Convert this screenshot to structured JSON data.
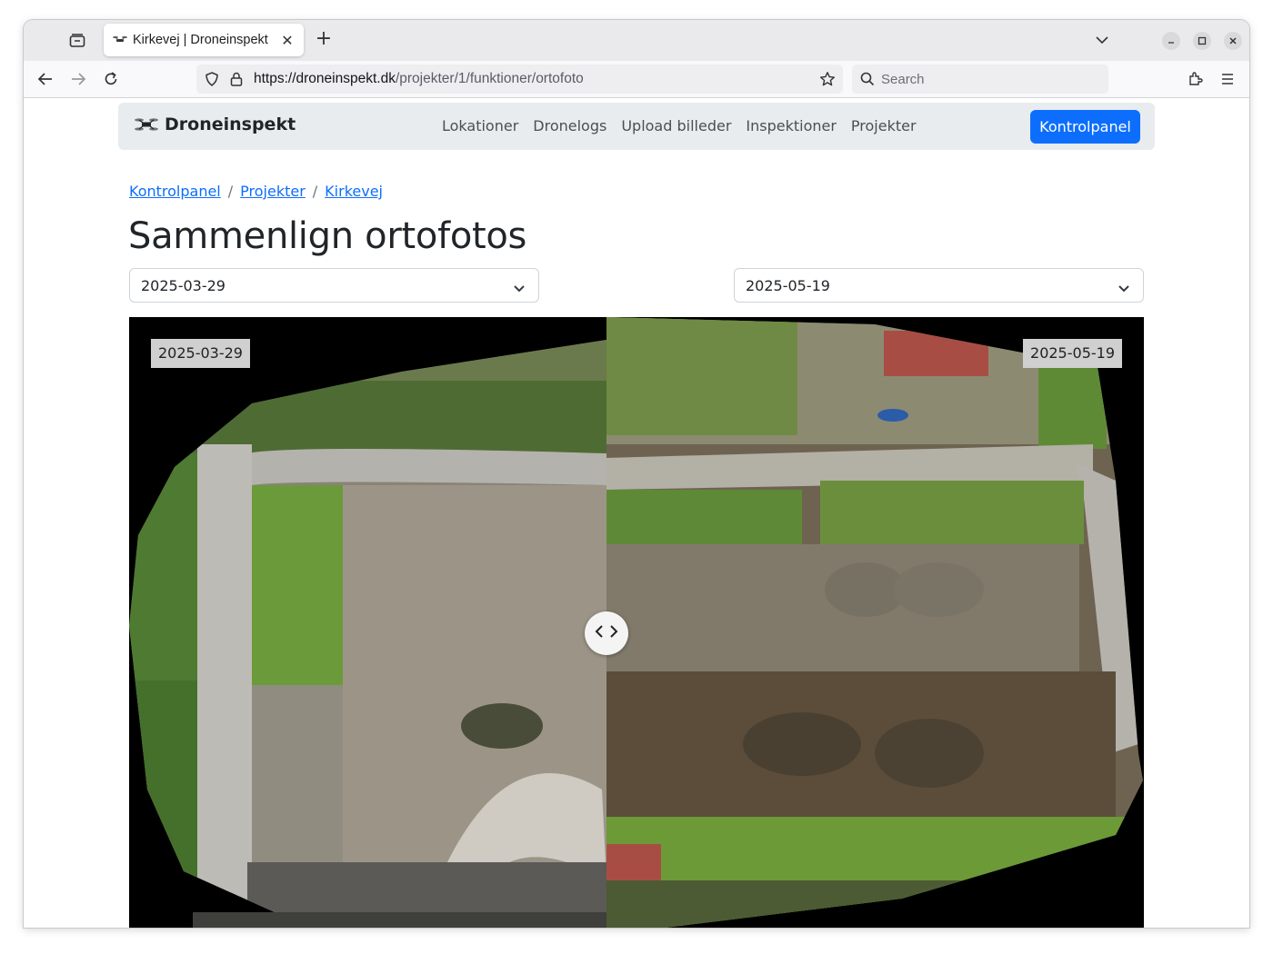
{
  "browser": {
    "tab_title": "Kirkevej | Droneinspekt",
    "url_host": "https://droneinspekt.dk",
    "url_path": "/projekter/1/funktioner/ortofoto",
    "search_placeholder": "Search"
  },
  "nav": {
    "brand": "Droneinspekt",
    "links": [
      "Lokationer",
      "Dronelogs",
      "Upload billeder",
      "Inspektioner",
      "Projekter"
    ],
    "cta": "Kontrolpanel"
  },
  "breadcrumb": {
    "items": [
      "Kontrolpanel",
      "Projekter",
      "Kirkevej"
    ],
    "separator": "/"
  },
  "page": {
    "title": "Sammenlign ortofotos"
  },
  "selects": {
    "left_value": "2025-03-29",
    "right_value": "2025-05-19"
  },
  "compare": {
    "left_label": "2025-03-29",
    "right_label": "2025-05-19",
    "split_percent": 47
  },
  "colors": {
    "primary": "#0d6efd",
    "navbar_bg": "#e9ecef",
    "link": "#0d6efd"
  }
}
